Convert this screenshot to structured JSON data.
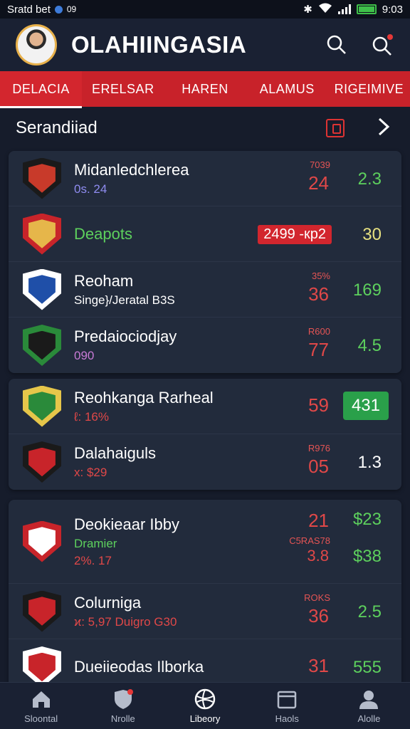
{
  "status_bar": {
    "left_text": "Sratd bet",
    "time_small": "09",
    "time": "9:03"
  },
  "header": {
    "title": "OLAHIINGASIA",
    "search_icon": "search-icon",
    "notify_icon": "search-notification-icon"
  },
  "tabs": [
    {
      "label": "DELACIA",
      "active": true
    },
    {
      "label": "ERELSAR",
      "active": false
    },
    {
      "label": "HAREN",
      "active": false
    },
    {
      "label": "ALAMUS",
      "active": false
    },
    {
      "label": "RIGEIMIVE",
      "active": false
    }
  ],
  "section": {
    "label": "Serandiiad"
  },
  "cards": [
    {
      "rows": [
        {
          "name": "Midanledchlerea",
          "sub": "0s. 24",
          "sub_color": "#8f8cf0",
          "odds_small": "7039",
          "odds_big": "24",
          "rate": "2.3",
          "rate_color": "#5dd05d",
          "crest": [
            "#1a1a1a",
            "#c83a2a"
          ]
        },
        {
          "name": "Deapots",
          "sub": "",
          "sub_color": "#5dd05d",
          "odds_small": "",
          "odds_big": "",
          "pill": "2499 -кр2",
          "rate": "30",
          "rate_color": "#e6e080",
          "crest": [
            "#c8242a",
            "#e6b64a"
          ]
        },
        {
          "name": "Reoham",
          "sub": "Singe}/Jeratal B3S",
          "sub_color": "#ffffff",
          "odds_small": "35%",
          "odds_big": "36",
          "rate": "169",
          "rate_color": "#5dd05d",
          "crest": [
            "#ffffff",
            "#1f4fa8"
          ]
        },
        {
          "name": "Predaiociodjay",
          "sub": "090",
          "sub_color": "#c87ad6",
          "odds_small": "R600",
          "odds_big": "77",
          "rate": "4.5",
          "rate_color": "#5dd05d",
          "crest": [
            "#2a8a3a",
            "#1a1a1a"
          ]
        }
      ]
    },
    {
      "rows": [
        {
          "name": "Reohkanga Rarheal",
          "sub": "ℓ: 16%",
          "sub_color": "#e04848",
          "odds_small": "",
          "odds_big": "59",
          "rate": "431",
          "rate_box": true,
          "rate_color": "#ffffff",
          "crest": [
            "#e6c64a",
            "#2a8a3a"
          ]
        },
        {
          "name": "Dalahaiguls",
          "sub": "x: $29",
          "sub_color": "#e04848",
          "odds_small": "R976",
          "odds_big": "05",
          "rate": "1.3",
          "rate_color": "#ffffff",
          "crest": [
            "#1a1a1a",
            "#c8242a"
          ]
        }
      ]
    },
    {
      "rows": [
        {
          "name": "Deokieaar Ibby",
          "sub": "Dramier",
          "sub2": "2%. 17",
          "sub_color": "#5dd05d",
          "odds_small": "",
          "odds_big": "21",
          "rate": "$23",
          "rate_color": "#5dd05d",
          "crest": [
            "#c8242a",
            "#ffffff"
          ],
          "tall": true,
          "extra_small": "C5RAS78",
          "extra_big": "3.8",
          "extra_rate": "$38"
        },
        {
          "name": "Colurniga",
          "sub": "ϰ: 5,97 Duigro G30",
          "sub_color": "#e04848",
          "odds_small": "ROKS",
          "odds_big": "36",
          "rate": "2.5",
          "rate_color": "#5dd05d",
          "crest": [
            "#1a1a1a",
            "#c8242a"
          ]
        },
        {
          "name": "Dueiieodas Ilborka",
          "sub": "",
          "sub_color": "#e04848",
          "odds_small": "",
          "odds_big": "31",
          "rate": "555",
          "rate_color": "#5dd05d",
          "crest": [
            "#ffffff",
            "#c8242a"
          ]
        }
      ]
    }
  ],
  "bottom_nav": [
    {
      "label": "Sloontal",
      "icon": "home-icon",
      "active": false
    },
    {
      "label": "Nrolle",
      "icon": "shield-icon",
      "active": false
    },
    {
      "label": "Libeory",
      "icon": "ball-icon",
      "active": true
    },
    {
      "label": "Haols",
      "icon": "tray-icon",
      "active": false
    },
    {
      "label": "Alolle",
      "icon": "profile-icon",
      "active": false
    }
  ]
}
